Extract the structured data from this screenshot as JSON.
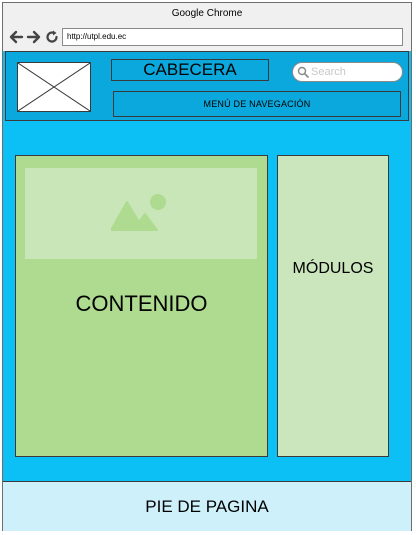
{
  "browser": {
    "title": "Google Chrome",
    "url": "http://utpl.edu.ec",
    "back_icon": "arrow-left-icon",
    "forward_icon": "arrow-right-icon",
    "reload_icon": "reload-icon"
  },
  "header": {
    "logo_icon": "image-placeholder-icon",
    "title": "CABECERA",
    "search": {
      "placeholder": "Search",
      "icon": "search-icon"
    },
    "nav_menu": "MENÚ DE NAVEGACIÓN"
  },
  "main": {
    "content": {
      "label": "CONTENIDO",
      "image_icon": "image-icon"
    },
    "modules": {
      "label": "MÓDULOS"
    }
  },
  "footer": {
    "label": "PIE DE PAGINA"
  },
  "colors": {
    "page_background": "#0cbff4",
    "header_background": "#0aa8dc",
    "content_background": "#aedb90",
    "modules_background": "#cbe5bd",
    "footer_background": "#cdf0fb"
  }
}
